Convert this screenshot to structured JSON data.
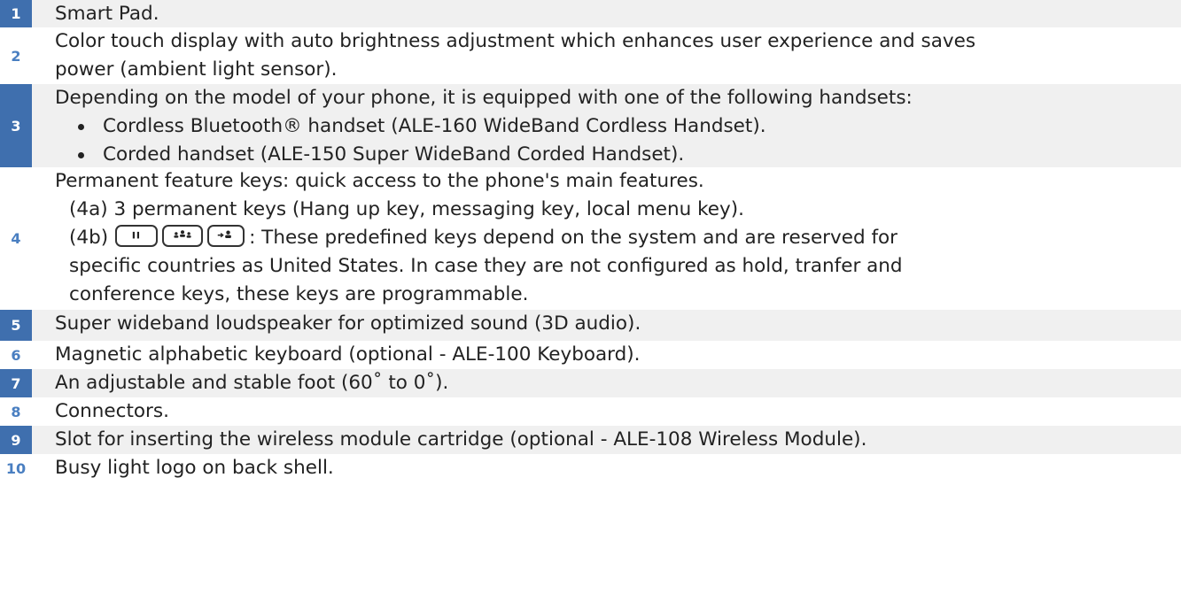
{
  "rows": [
    {
      "num": "1",
      "text": "Smart Pad."
    },
    {
      "num": "2",
      "lines": [
        "Color touch display with auto brightness adjustment which enhances user experience and saves",
        "power (ambient light sensor)."
      ]
    },
    {
      "num": "3",
      "intro": "Depending on the model of your phone, it is equipped with one of the following handsets:",
      "bullets": [
        "Cordless Bluetooth® handset (ALE-160 WideBand Cordless Handset).",
        "Corded handset (ALE-150 Super WideBand Corded Handset)."
      ]
    },
    {
      "num": "4",
      "intro": "Permanent feature keys: quick access to the phone's main features.",
      "item_a": "(4a) 3 permanent keys (Hang up key, messaging key, local menu key).",
      "item_b_prefix": "(4b)",
      "item_b_text": ": These predefined keys depend on the system and are reserved for",
      "item_b_cont": [
        "specific countries as United States. In case they are not configured as hold, tranfer and",
        "conference keys, these keys are programmable."
      ],
      "key_icons": [
        "hold-key-icon",
        "conference-key-icon",
        "transfer-key-icon"
      ]
    },
    {
      "num": "5",
      "text": "Super wideband loudspeaker for optimized sound (3D audio)."
    },
    {
      "num": "6",
      "text": "Magnetic alphabetic keyboard (optional - ALE-100 Keyboard)."
    },
    {
      "num": "7",
      "text": "An adjustable and stable foot (60˚ to 0˚)."
    },
    {
      "num": "8",
      "text": "Connectors."
    },
    {
      "num": "9",
      "text": "Slot for inserting the wireless module cartridge (optional - ALE-108 Wireless Module)."
    },
    {
      "num": "10",
      "text": "Busy light logo on back shell."
    }
  ],
  "colors": {
    "number_cell_bg": "#3f6fae",
    "number_text_plain": "#4a7fc1",
    "shaded_row_bg": "#f0f0f0"
  }
}
